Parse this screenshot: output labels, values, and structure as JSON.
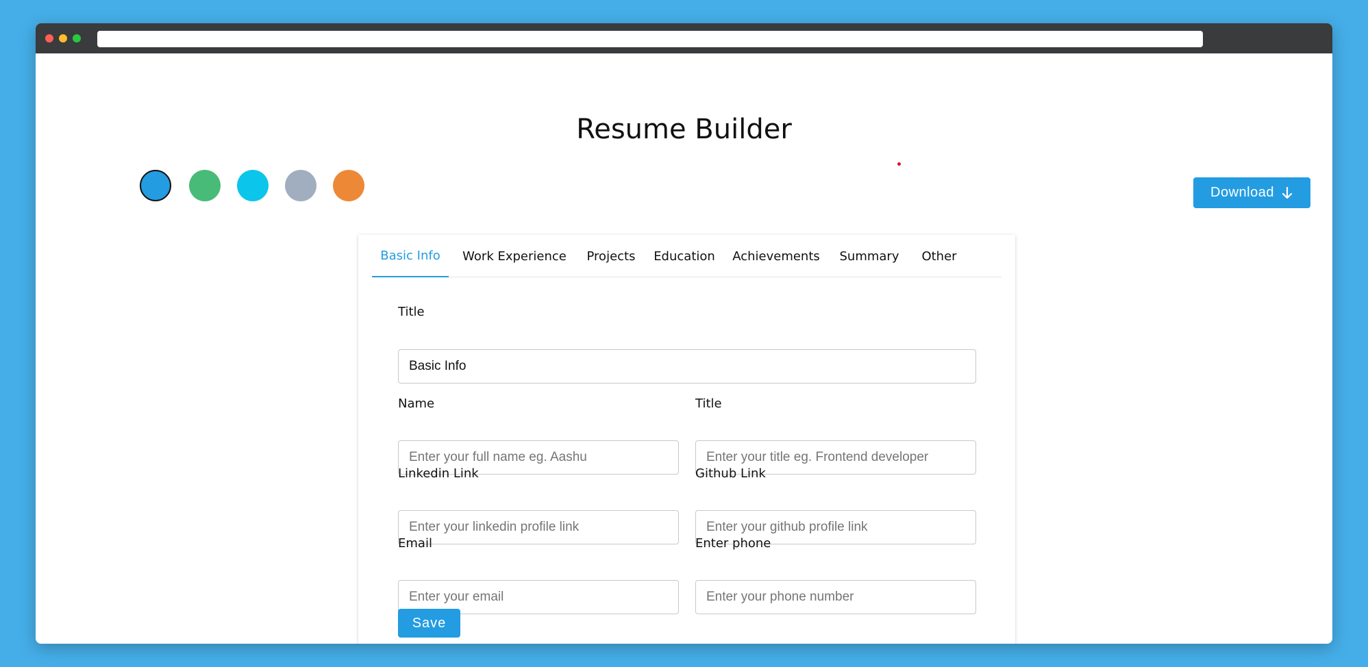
{
  "colors": {
    "background": "#45aee8",
    "accent": "#239ce2",
    "red_dot": "#d9152a"
  },
  "header": {
    "title": "Resume Builder"
  },
  "swatches": [
    {
      "name": "blue",
      "color": "#239ce2",
      "active": true
    },
    {
      "name": "green",
      "color": "#48bb78",
      "active": false
    },
    {
      "name": "cyan",
      "color": "#0bc5ea",
      "active": false
    },
    {
      "name": "gray",
      "color": "#a0aec0",
      "active": false
    },
    {
      "name": "orange",
      "color": "#ed8936",
      "active": false
    }
  ],
  "download": {
    "label": "Download",
    "icon": "arrow-down-icon"
  },
  "tabs": [
    {
      "label": "Basic Info",
      "active": true
    },
    {
      "label": "Work Experience",
      "active": false
    },
    {
      "label": "Projects",
      "active": false
    },
    {
      "label": "Education",
      "active": false
    },
    {
      "label": "Achievements",
      "active": false
    },
    {
      "label": "Summary",
      "active": false
    },
    {
      "label": "Other",
      "active": false
    }
  ],
  "form": {
    "section_title_label": "Title",
    "section_title_value": "Basic Info",
    "name_label": "Name",
    "name_placeholder": "Enter your full name eg. Aashu",
    "title_label": "Title",
    "title_placeholder": "Enter your title eg. Frontend developer",
    "linkedin_label": "Linkedin Link",
    "linkedin_placeholder": "Enter your linkedin profile link",
    "github_label": "Github Link",
    "github_placeholder": "Enter your github profile link",
    "email_label": "Email",
    "email_placeholder": "Enter your email",
    "phone_label": "Enter phone",
    "phone_placeholder": "Enter your phone number",
    "save_label": "Save"
  }
}
